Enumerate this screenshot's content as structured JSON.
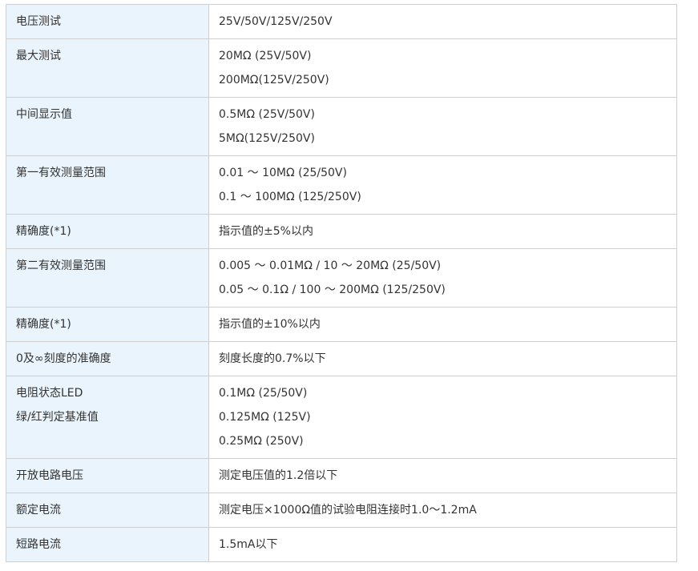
{
  "rows": [
    {
      "label": [
        "电压测试"
      ],
      "values": [
        "25V/50V/125V/250V"
      ]
    },
    {
      "label": [
        "最大测试"
      ],
      "values": [
        "20MΩ (25V/50V)",
        "200MΩ(125V/250V)"
      ]
    },
    {
      "label": [
        "中间显示值"
      ],
      "values": [
        "0.5MΩ (25V/50V)",
        "5MΩ(125V/250V)"
      ]
    },
    {
      "label": [
        "第一有效测量范围"
      ],
      "values": [
        "0.01 〜 10MΩ (25/50V)",
        "0.1 〜 100MΩ (125/250V)"
      ]
    },
    {
      "label": [
        "精确度(*1)"
      ],
      "values": [
        "指示值的±5%以内"
      ]
    },
    {
      "label": [
        "第二有效测量范围"
      ],
      "values": [
        "0.005 〜 0.01MΩ / 10 〜 20MΩ (25/50V)",
        "0.05 〜 0.1Ω / 100 〜 200MΩ (125/250V)"
      ]
    },
    {
      "label": [
        "精确度(*1)"
      ],
      "values": [
        "指示值的±10%以内"
      ]
    },
    {
      "label": [
        "0及∞刻度的准确度"
      ],
      "values": [
        "刻度长度的0.7%以下"
      ]
    },
    {
      "label": [
        "电阻状态LED",
        "绿/红判定基准值"
      ],
      "values": [
        "0.1MΩ (25/50V)",
        "0.125MΩ (125V)",
        "0.25MΩ (250V)"
      ]
    },
    {
      "label": [
        "开放电路电压"
      ],
      "values": [
        "测定电压值的1.2倍以下"
      ]
    },
    {
      "label": [
        "额定电流"
      ],
      "values": [
        "测定电压×1000Ω值的试验电阻连接时1.0〜1.2mA"
      ]
    },
    {
      "label": [
        "短路电流"
      ],
      "values": [
        "1.5mA以下"
      ]
    }
  ]
}
